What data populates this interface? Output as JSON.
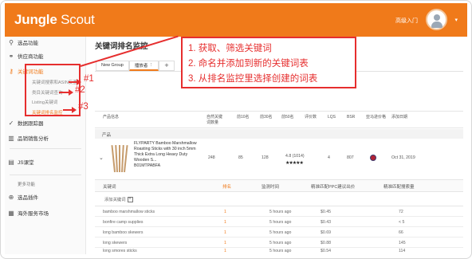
{
  "app": {
    "logo_bold": "Jungle",
    "logo_light": "Scout",
    "login_text": "高级入门",
    "dropdown": "▾"
  },
  "sidebar": {
    "items": [
      {
        "label": "选品功能",
        "icon": "search-icon"
      },
      {
        "label": "供应商功能",
        "icon": "link-icon"
      },
      {
        "label": "关键词功能",
        "icon": "key-icon"
      },
      {
        "label": "数据跟踪器",
        "icon": "check-icon"
      },
      {
        "label": "品销销售分析",
        "icon": "chart-icon"
      },
      {
        "label": "JS课堂",
        "icon": "book-icon"
      },
      {
        "label": "选品插件",
        "icon": "plugin-icon"
      },
      {
        "label": "海外服务市场",
        "icon": "grid-icon"
      }
    ],
    "subitems": [
      "关键词搜索和ASIN反查",
      "类目关键词查询",
      "Listing关键词",
      "关键词排名监控"
    ],
    "group_label": "更多功能"
  },
  "main": {
    "title": "关键词排名监控",
    "tabs": [
      "New Group",
      "播放者"
    ],
    "tab_plus": "+",
    "table_headers": [
      "产品信息",
      "自然关键词数量",
      "前10名",
      "前30名",
      "前50名",
      "评价数",
      "LQS",
      "BSR",
      "亚马逊价格",
      "添加日期"
    ],
    "group_row": "产品",
    "product": {
      "name": "FLYPARTY Bamboo Marshmallow Roasting Sticks with 30 inch 5mm Thick Extra Long Heavy Duty Wooden S...",
      "asin": "B01MTPABFA",
      "keywords": "248",
      "top10": "85",
      "top30": "128",
      "rating_text": "4.8 (1014)",
      "stars": "★★★★★",
      "lqs": "4",
      "bsr": "807",
      "date": "Oct 31, 2019"
    },
    "kw_headers": [
      "关键词",
      "排名",
      "监测时间",
      "精准匹配PPC建议出价",
      "精准匹配搜索量"
    ],
    "add_keyword": "添加关键词",
    "add_keyword_plus": "+",
    "keywords": [
      {
        "kw": "bamboo marshmallow sticks",
        "rank": "1",
        "time": "5 hours ago",
        "bid": "$0.45",
        "vol": "72"
      },
      {
        "kw": "bonfire camp supplies",
        "rank": "1",
        "time": "5 hours ago",
        "bid": "$0.43",
        "vol": "< 5"
      },
      {
        "kw": "long bamboo skewers",
        "rank": "1",
        "time": "5 hours ago",
        "bid": "$0.69",
        "vol": "66"
      },
      {
        "kw": "long skewers",
        "rank": "1",
        "time": "5 hours ago",
        "bid": "$0.88",
        "vol": "145"
      },
      {
        "kw": "long smores sticks",
        "rank": "1",
        "time": "5 hours ago",
        "bid": "$0.54",
        "vol": "114"
      }
    ]
  },
  "annotation": {
    "lines": [
      "1. 获取、筛选关键词",
      "2. 命名并添加到新的关键词表",
      "3. 从排名监控里选择创建的词表"
    ],
    "markers": [
      "#1",
      "#2",
      "#3"
    ],
    "color": "#e62e2e"
  },
  "colors": {
    "brand": "#f07a1a"
  }
}
